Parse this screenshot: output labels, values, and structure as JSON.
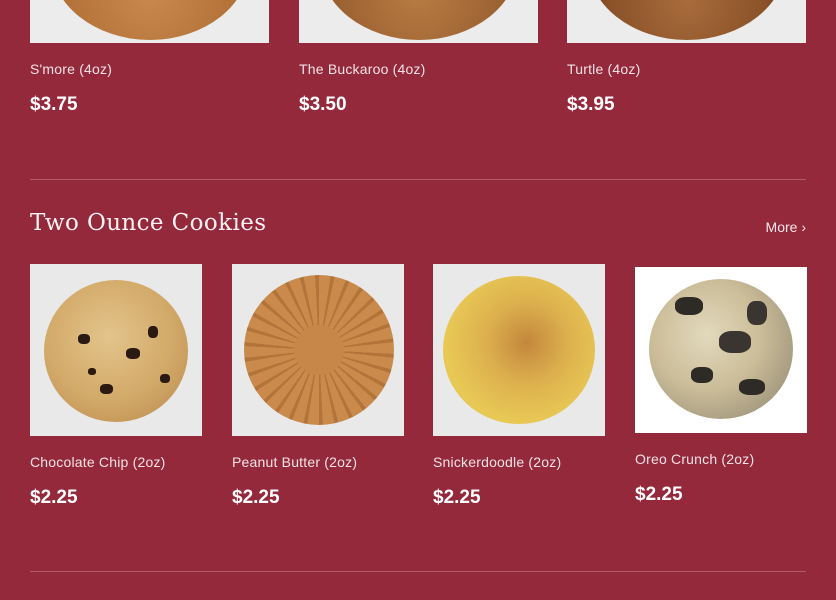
{
  "top_products": [
    {
      "name": "S'more (4oz)",
      "price": "$3.75",
      "image_icon": "smore-cookie-image"
    },
    {
      "name": "The Buckaroo (4oz)",
      "price": "$3.50",
      "image_icon": "buckaroo-cookie-image"
    },
    {
      "name": "Turtle (4oz)",
      "price": "$3.95",
      "image_icon": "turtle-cookie-image"
    }
  ],
  "section": {
    "title": "Two Ounce Cookies",
    "more_label": "More ›"
  },
  "products": [
    {
      "name": "Chocolate Chip (2oz)",
      "price": "$2.25",
      "image_icon": "chocolate-chip-cookie-image"
    },
    {
      "name": "Peanut Butter (2oz)",
      "price": "$2.25",
      "image_icon": "peanut-butter-cookie-image"
    },
    {
      "name": "Snickerdoodle (2oz)",
      "price": "$2.25",
      "image_icon": "snickerdoodle-cookie-image"
    },
    {
      "name": "Oreo Crunch (2oz)",
      "price": "$2.25",
      "image_icon": "oreo-crunch-cookie-image"
    }
  ],
  "colors": {
    "background": "#94293c",
    "text": "#f6e7ea",
    "divider": "#b15a69"
  }
}
